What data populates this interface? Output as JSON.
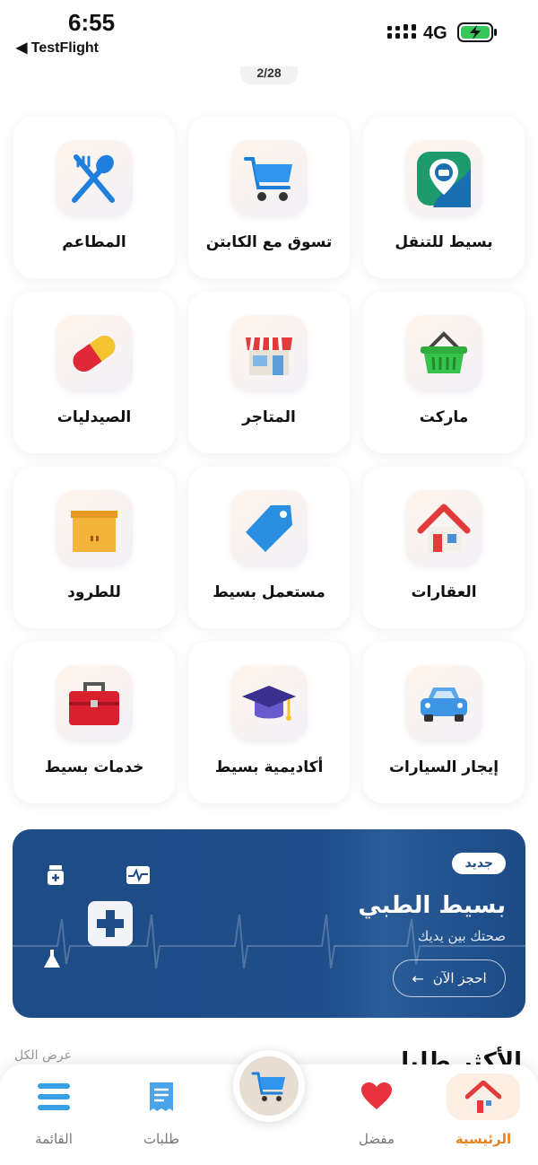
{
  "status": {
    "time": "6:55",
    "back_app": "◀ TestFlight",
    "network": "4G"
  },
  "page_indicator": "2/28",
  "services": [
    {
      "label": "بسيط للتنقل",
      "icon": "map-pin-car-icon"
    },
    {
      "label": "تسوق مع الكابتن",
      "icon": "shopping-cart-icon"
    },
    {
      "label": "المطاعم",
      "icon": "fork-spoon-icon"
    },
    {
      "label": "ماركت",
      "icon": "basket-icon"
    },
    {
      "label": "المتاجر",
      "icon": "storefront-icon"
    },
    {
      "label": "الصيدليات",
      "icon": "pill-icon"
    },
    {
      "label": "العقارات",
      "icon": "house-icon"
    },
    {
      "label": "مستعمل بسيط",
      "icon": "price-tag-icon"
    },
    {
      "label": "للطرود",
      "icon": "parcel-box-icon"
    },
    {
      "label": "إيجار السيارات",
      "icon": "car-icon"
    },
    {
      "label": "أكاديمية بسيط",
      "icon": "graduation-cap-icon"
    },
    {
      "label": "خدمات بسيط",
      "icon": "toolbox-icon"
    }
  ],
  "banner": {
    "badge": "جديد",
    "title": "بسيط الطبي",
    "subtitle": "صحتك بين يديك",
    "button": "احجز الآن",
    "colors": {
      "background": "#1e4c86"
    }
  },
  "peek_text": {
    "right": "الأكثر طلبا",
    "left": "عرض الكل"
  },
  "nav": {
    "home": "الرئيسية",
    "favorites": "مفضل",
    "orders": "طلبات",
    "menu": "القائمة",
    "active_color": "#e8821f"
  }
}
